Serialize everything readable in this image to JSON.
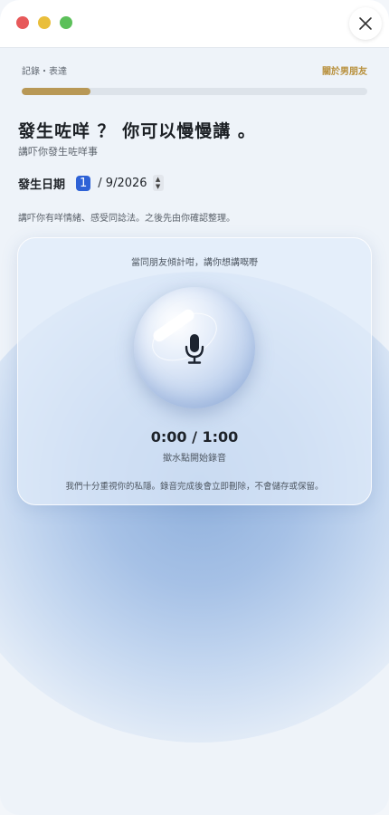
{
  "header": {
    "section_label": "記錄・表達",
    "topic_label": "關於男朋友",
    "progress_fraction": 0.2
  },
  "main": {
    "heading": "發生咗咩 ？ 你可以慢慢講 。",
    "subheading": "講吓你發生咗咩事",
    "date": {
      "label": "發生日期",
      "month": "1",
      "rest": "/ 9/2026"
    },
    "hint": "講吓你有咩情緒、感受同諗法。之後先由你確認整理。"
  },
  "recorder": {
    "prompt": "當同朋友傾計咁，講你想講嘅嘢",
    "timer": "0:00 / 1:00",
    "tap_hint": "撳水點開始錄音",
    "privacy": "我們十分重視你的私隱。錄音完成後會立即刪除，不會儲存或保留。"
  },
  "colors": {
    "accent": "#b8903c",
    "progress_fill": "#b89856",
    "date_highlight": "#2e62d6"
  },
  "icons": {
    "close": "close-icon",
    "mic": "microphone-icon",
    "stepper": "stepper-icon"
  }
}
